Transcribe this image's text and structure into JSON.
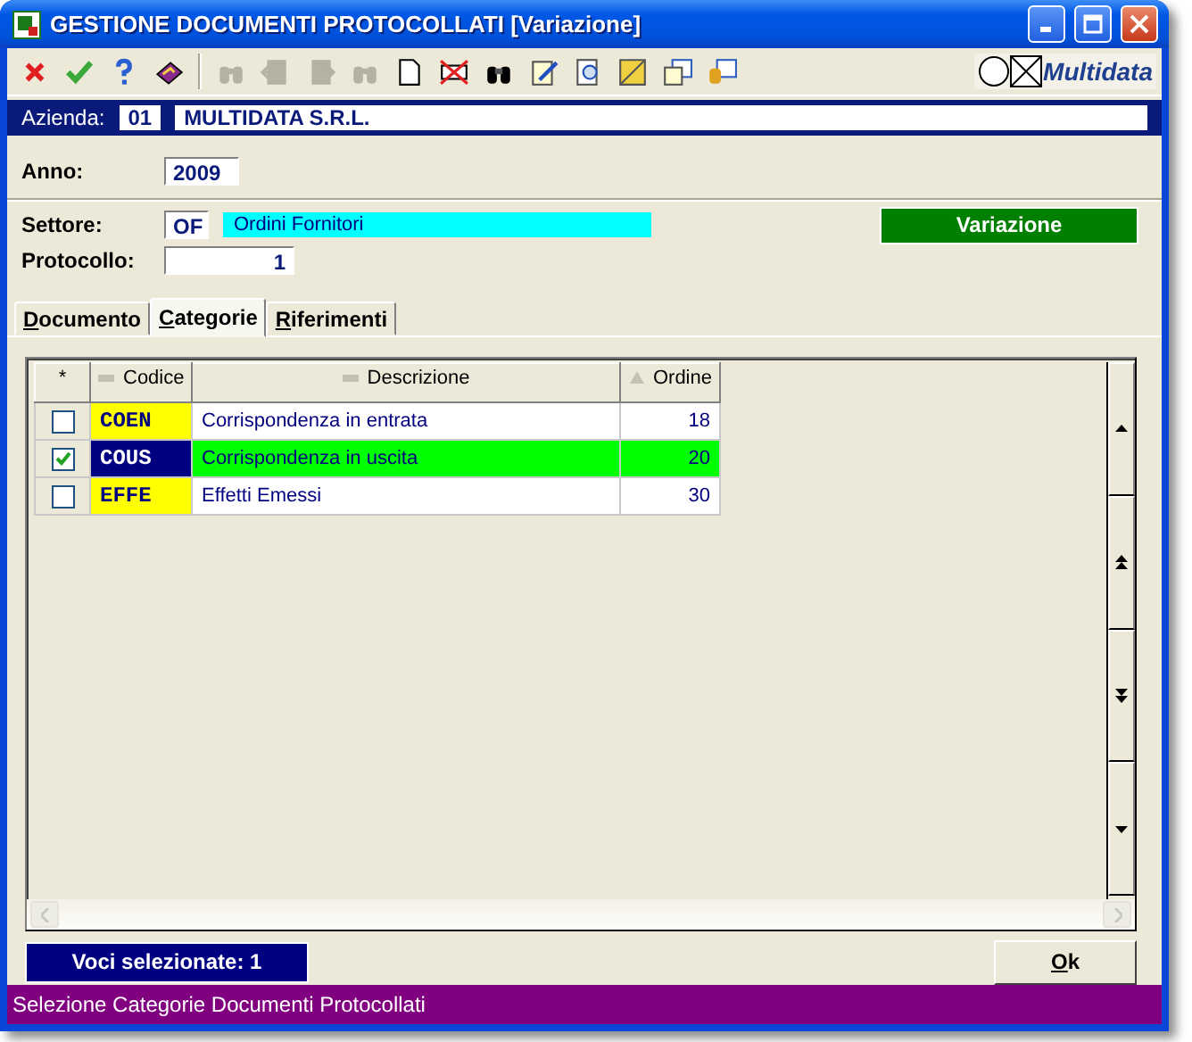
{
  "window": {
    "title": "GESTIONE DOCUMENTI PROTOCOLLATI [Variazione]"
  },
  "toolbar": [
    {
      "kind": "cancel",
      "disabled": false
    },
    {
      "kind": "confirm",
      "disabled": false
    },
    {
      "kind": "help",
      "disabled": false
    },
    {
      "kind": "book",
      "disabled": false
    },
    {
      "kind": "find",
      "disabled": true
    },
    {
      "kind": "previous",
      "disabled": true
    },
    {
      "kind": "next",
      "disabled": true
    },
    {
      "kind": "find",
      "disabled": true
    },
    {
      "kind": "new",
      "disabled": false
    },
    {
      "kind": "delete",
      "disabled": false
    },
    {
      "kind": "search",
      "disabled": false
    },
    {
      "kind": "edit",
      "disabled": false
    },
    {
      "kind": "preview",
      "disabled": false
    },
    {
      "kind": "layout",
      "disabled": false
    },
    {
      "kind": "windows",
      "disabled": false
    },
    {
      "kind": "database",
      "disabled": false
    }
  ],
  "brand": "Multidata",
  "company": {
    "label": "Azienda:",
    "code": "01",
    "name": "MULTIDATA S.R.L."
  },
  "form": {
    "year": {
      "label": "Anno:",
      "value": "2009"
    },
    "sector": {
      "label": "Settore:",
      "code": "OF",
      "name": "Ordini Fornitori"
    },
    "protocol": {
      "label": "Protocollo:",
      "value": "1"
    }
  },
  "mode": "Variazione",
  "tabs": [
    {
      "label": "Documento",
      "selected": false
    },
    {
      "label": "Categorie",
      "selected": true
    },
    {
      "label": "Riferimenti",
      "selected": false
    }
  ],
  "table": {
    "columns": [
      {
        "label": "*"
      },
      {
        "label": "Codice",
        "sorted": false
      },
      {
        "label": "Descrizione",
        "sorted": false
      },
      {
        "label": "Ordine",
        "sorted": true
      }
    ],
    "rows": [
      {
        "checked": false,
        "selected": false,
        "code": "COEN",
        "description": "Corrispondenza in entrata",
        "order": "18"
      },
      {
        "checked": true,
        "selected": true,
        "code": "COUS",
        "description": "Corrispondenza in uscita",
        "order": "20"
      },
      {
        "checked": false,
        "selected": false,
        "code": "EFFE",
        "description": "Effetti Emessi",
        "order": "30"
      }
    ]
  },
  "selected_count": "Voci selezionate: 1",
  "buttons": [
    {
      "label": "Ok"
    }
  ],
  "status_bar": "Selezione Categorie Documenti Protocollati"
}
